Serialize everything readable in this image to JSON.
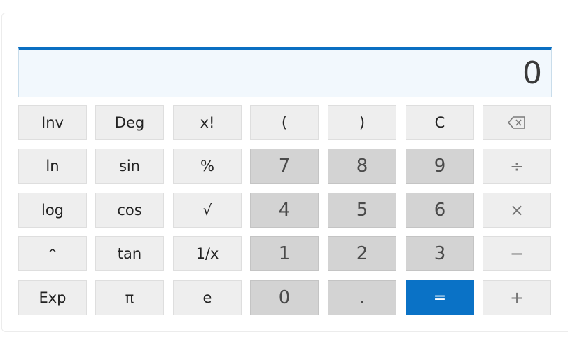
{
  "display": {
    "value": "0"
  },
  "keys": {
    "inv": "Inv",
    "deg": "Deg",
    "factorial": "x!",
    "lparen": "(",
    "rparen": ")",
    "clear": "C",
    "ln": "ln",
    "sin": "sin",
    "percent": "%",
    "seven": "7",
    "eight": "8",
    "nine": "9",
    "divide": "÷",
    "log": "log",
    "cos": "cos",
    "sqrt": "√",
    "four": "4",
    "five": "5",
    "six": "6",
    "multiply": "×",
    "power": "^",
    "tan": "tan",
    "reciprocal": "1/x",
    "one": "1",
    "two": "2",
    "three": "3",
    "minus": "−",
    "exp": "Exp",
    "pi": "π",
    "e": "e",
    "zero": "0",
    "decimal": ".",
    "equals": "=",
    "plus": "+"
  },
  "icons": {
    "backspace": "backspace-icon"
  },
  "colors": {
    "accent": "#0a72c6",
    "display_bg": "#f2f8fd",
    "function_key": "#eeeeee",
    "number_key": "#d3d3d3"
  }
}
